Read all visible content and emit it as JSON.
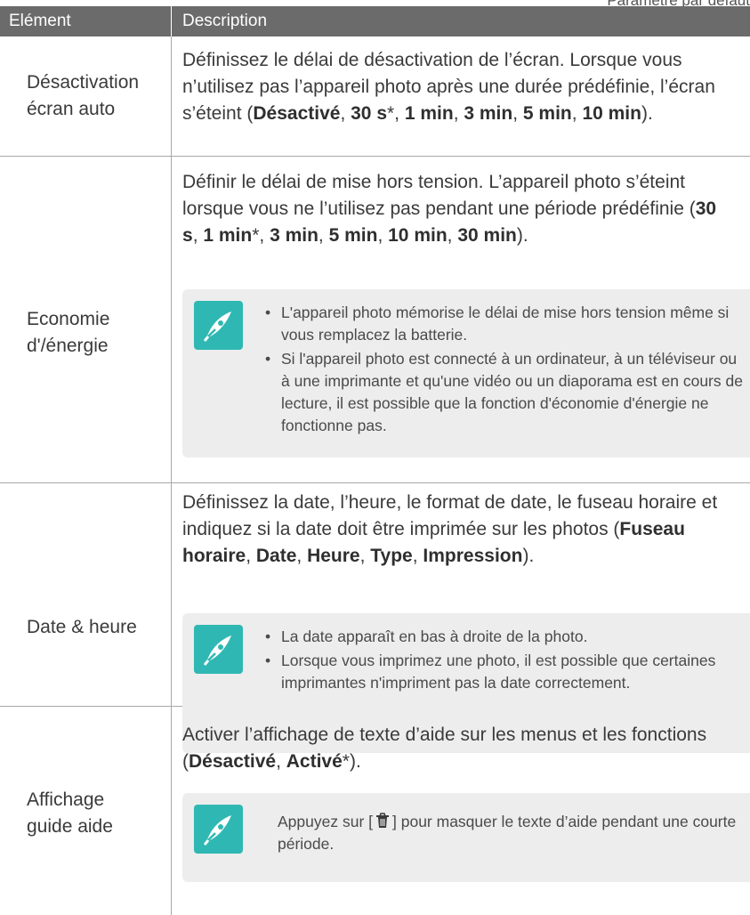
{
  "top_note": "Paramètre par défaut",
  "header": {
    "col1": "Elément",
    "col2": "Description"
  },
  "rows": [
    {
      "element": "Désactivation écran auto",
      "desc_parts": [
        {
          "t": "Définissez le délai de désactivation de l’écran. Lorsque vous n’utilisez pas l’appareil photo après une durée prédéfinie, l’écran s’éteint ("
        },
        {
          "b": "Désactivé"
        },
        {
          "t": ", "
        },
        {
          "b": "30 s"
        },
        {
          "t": "*, "
        },
        {
          "b": "1 min"
        },
        {
          "t": ", "
        },
        {
          "b": "3 min"
        },
        {
          "t": ", "
        },
        {
          "b": "5 min"
        },
        {
          "t": ", "
        },
        {
          "b": "10 min"
        },
        {
          "t": ")."
        }
      ]
    },
    {
      "element": "Economie d'/énergie",
      "element_lines": [
        "Economie",
        "d'/énergie"
      ],
      "desc_parts": [
        {
          "t": "Définir le délai de mise hors tension. L’appareil photo s’éteint lorsque vous ne l’utilisez pas pendant une période prédéfinie ("
        },
        {
          "b": "30 s"
        },
        {
          "t": ", "
        },
        {
          "b": "1 min"
        },
        {
          "t": "*, "
        },
        {
          "b": "3 min"
        },
        {
          "t": ", "
        },
        {
          "b": "5 min"
        },
        {
          "t": ", "
        },
        {
          "b": "10 min"
        },
        {
          "t": ", "
        },
        {
          "b": "30 min"
        },
        {
          "t": ")."
        }
      ],
      "note_items": [
        "L'appareil photo mémorise le délai de mise hors tension même si vous remplacez la batterie.",
        "Si l'appareil photo est connecté à un ordinateur, à un téléviseur ou à une imprimante et qu'une vidéo ou un diaporama est en cours de lecture, il est possible que la fonction d'économie d'énergie ne fonctionne pas."
      ]
    },
    {
      "element": "Date & heure",
      "desc_parts": [
        {
          "t": "Définissez la date, l’heure, le format de date, le fuseau horaire et indiquez si la date doit être imprimée sur les photos ("
        },
        {
          "b": "Fuseau horaire"
        },
        {
          "t": ", "
        },
        {
          "b": "Date"
        },
        {
          "t": ", "
        },
        {
          "b": "Heure"
        },
        {
          "t": ", "
        },
        {
          "b": "Type"
        },
        {
          "t": ", "
        },
        {
          "b": "Impression"
        },
        {
          "t": ")."
        }
      ],
      "note_items": [
        "La date apparaît en bas à droite de la photo.",
        "Lorsque vous imprimez une photo, il est possible que certaines imprimantes n'impriment pas la date correctement."
      ]
    },
    {
      "element": "Affichage guide aide",
      "desc_parts": [
        {
          "t": "Activer l’affichage de texte d’aide sur les menus et les fonctions ("
        },
        {
          "b": "Désactivé"
        },
        {
          "t": ", "
        },
        {
          "b": "Activé"
        },
        {
          "t": "*)."
        }
      ],
      "note_text_before": "Appuyez sur [",
      "note_icon": "trash-icon",
      "note_text_after": "] pour masquer le texte d’aide pendant une courte période."
    }
  ],
  "colors": {
    "header_bg": "#6b6b6b",
    "note_bg": "#ededed",
    "note_icon": "#2fb8b3",
    "rule": "#a8a8a8"
  }
}
